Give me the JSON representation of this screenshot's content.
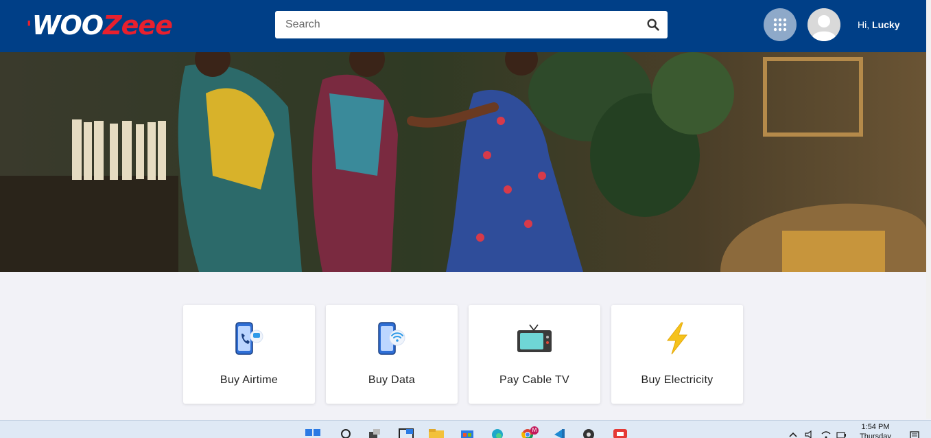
{
  "header": {
    "logo": "WOOZeee",
    "search_placeholder": "Search",
    "greeting_prefix": "Hi,",
    "user_name": "Lucky"
  },
  "services": [
    {
      "label": "Buy Airtime",
      "icon": "phone-call-icon"
    },
    {
      "label": "Buy Data",
      "icon": "phone-wifi-icon"
    },
    {
      "label": "Pay Cable TV",
      "icon": "tv-icon"
    },
    {
      "label": "Buy Electricity",
      "icon": "lightning-icon"
    }
  ],
  "taskbar": {
    "time": "1:54 PM",
    "day": "Thursday",
    "apps": [
      "windows-start-icon",
      "search-icon",
      "task-view-icon",
      "widgets-icon",
      "file-explorer-icon",
      "store-icon",
      "edge-icon",
      "chrome-icon",
      "vscode-icon",
      "obs-icon",
      "app-icon"
    ],
    "chrome_badge": "M"
  },
  "colors": {
    "header_bg": "#003f87",
    "logo_red": "#e8202e",
    "page_bg": "#f2f2f7",
    "apps_button": "#8ea9c9"
  }
}
